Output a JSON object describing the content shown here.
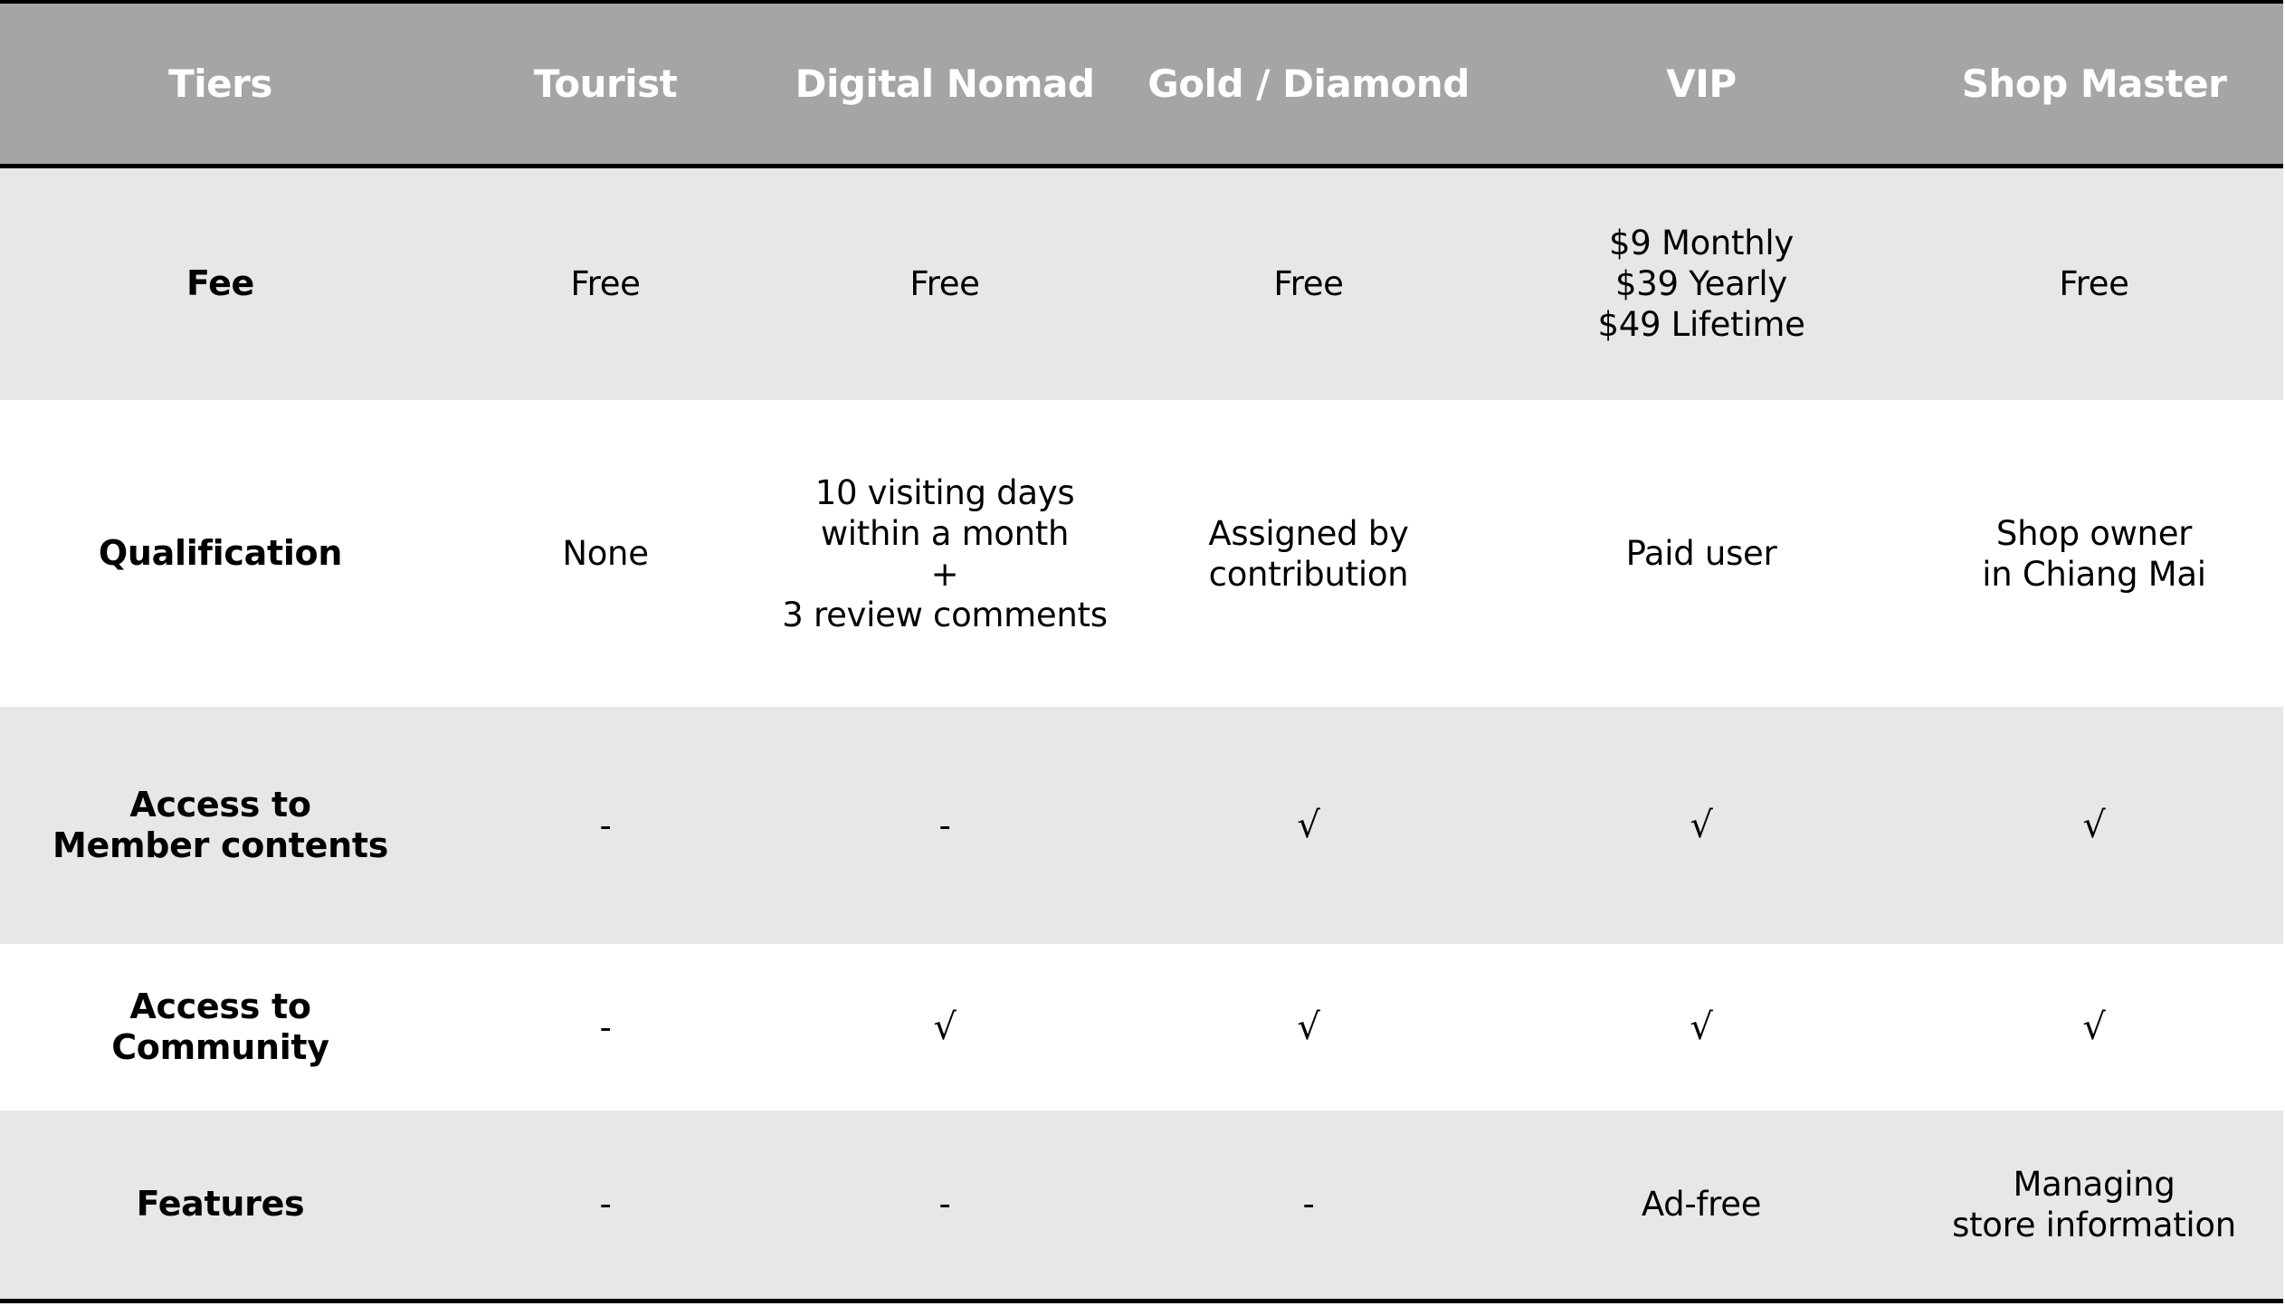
{
  "table": {
    "header": {
      "row_label": "Tiers",
      "tiers": [
        "Tourist",
        "Digital Nomad",
        "Gold / Diamond",
        "VIP",
        "Shop Master"
      ]
    },
    "rows": {
      "fee": {
        "label": "Fee",
        "cells": [
          [
            "Free"
          ],
          [
            "Free"
          ],
          [
            "Free"
          ],
          [
            "$9 Monthly",
            "$39 Yearly",
            "$49 Lifetime"
          ],
          [
            "Free"
          ]
        ]
      },
      "qualification": {
        "label": "Qualification",
        "cells": [
          [
            "None"
          ],
          [
            "10 visiting days",
            "within a month",
            "+",
            "3 review comments"
          ],
          [
            "Assigned by",
            "contribution"
          ],
          [
            "Paid user"
          ],
          [
            "Shop owner",
            "in Chiang Mai"
          ]
        ]
      },
      "member_contents": {
        "label_lines": [
          "Access to",
          "Member contents"
        ],
        "cells": [
          "-",
          "-",
          "√",
          "√",
          "√"
        ]
      },
      "community": {
        "label_lines": [
          "Access to",
          "Community"
        ],
        "cells": [
          "-",
          "√",
          "√",
          "√",
          "√"
        ]
      },
      "features": {
        "label": "Features",
        "cells": [
          [
            "-"
          ],
          [
            "-"
          ],
          [
            "-"
          ],
          [
            "Ad-free"
          ],
          [
            "Managing",
            "store information"
          ]
        ]
      }
    },
    "colors": {
      "header_bg": "#a5a5a5",
      "header_text": "#ffffff",
      "shaded_row_bg": "#e7e7e7",
      "plain_row_bg": "#ffffff",
      "border": "#000000",
      "text": "#000000"
    }
  }
}
